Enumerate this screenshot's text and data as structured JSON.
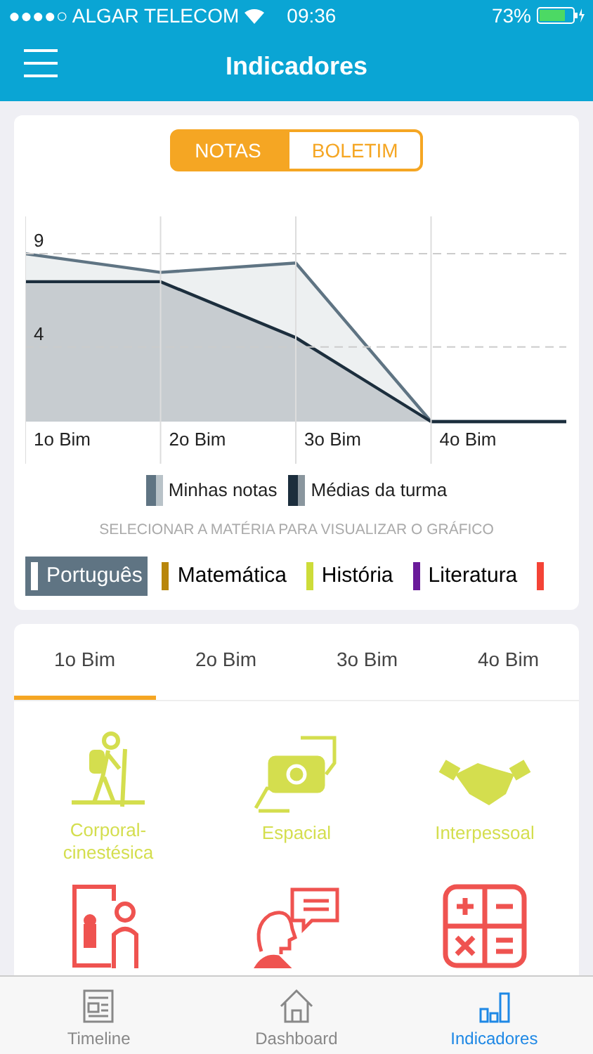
{
  "status_bar": {
    "carrier": "●●●●○ ALGAR TELECOM",
    "time": "09:36",
    "battery": "73%"
  },
  "nav": {
    "title": "Indicadores"
  },
  "toggle": [
    {
      "label": "NOTAS",
      "selected": true
    },
    {
      "label": "BOLETIM",
      "selected": false
    }
  ],
  "chart_data": {
    "type": "area",
    "legend": "bottom",
    "categories": [
      "1o Bim",
      "2o Bim",
      "3o Bim",
      "4o Bim"
    ],
    "ylim": [
      0,
      11
    ],
    "yticks": [
      4,
      9
    ],
    "series": [
      {
        "name": "Minhas notas",
        "color": "#5f7483",
        "values": [
          9,
          8,
          8.5,
          0
        ]
      },
      {
        "name": "Médias da turma",
        "color": "#1c2e3d",
        "values": [
          7.5,
          7.5,
          4.5,
          0
        ]
      }
    ]
  },
  "hint": "SELECIONAR A MATÉRIA PARA VISUALIZAR O GRÁFICO",
  "subjects": [
    {
      "label": "Português",
      "color": "#ffffff",
      "selected": true
    },
    {
      "label": "Matemática",
      "color": "#b8860b",
      "selected": false
    },
    {
      "label": "História",
      "color": "#cddc39",
      "selected": false
    },
    {
      "label": "Literatura",
      "color": "#6a1b9a",
      "selected": false
    },
    {
      "color": "#f44336",
      "selected": false
    }
  ],
  "period_tabs": [
    {
      "label": "1o Bim",
      "selected": true
    },
    {
      "label": "2o Bim",
      "selected": false
    },
    {
      "label": "3o Bim",
      "selected": false
    },
    {
      "label": "4o Bim",
      "selected": false
    }
  ],
  "intelligences": [
    {
      "kind": "hiker",
      "label": "Corporal-cinestésica",
      "color": "#d4de4e"
    },
    {
      "kind": "camera",
      "label": "Espacial",
      "color": "#d4de4e"
    },
    {
      "kind": "handshake",
      "label": "Interpessoal",
      "color": "#d4de4e"
    },
    {
      "kind": "mirror",
      "color": "#ef5350"
    },
    {
      "kind": "speech",
      "color": "#ef5350"
    },
    {
      "kind": "calculator",
      "color": "#ef5350"
    }
  ],
  "tab_bar": [
    {
      "label": "Timeline",
      "selected": false
    },
    {
      "label": "Dashboard",
      "selected": false
    },
    {
      "label": "Indicadores",
      "selected": true
    }
  ]
}
